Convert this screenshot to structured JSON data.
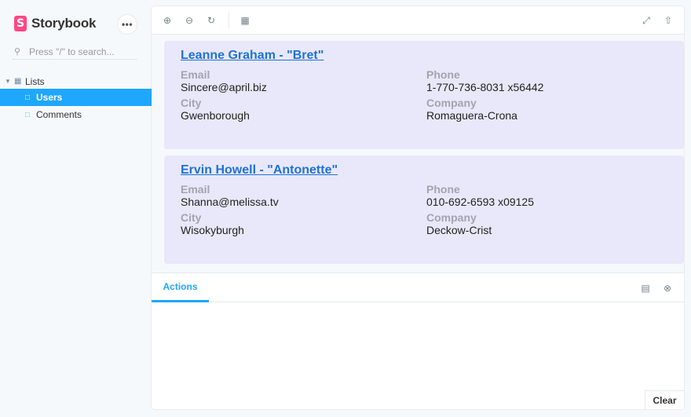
{
  "app": {
    "name": "Storybook",
    "logo_letter": "S",
    "menu_glyph": "•••"
  },
  "search": {
    "placeholder": "Press \"/\" to search..."
  },
  "sidebar": {
    "group": {
      "label": "Lists"
    },
    "items": [
      {
        "label": "Users",
        "active": true
      },
      {
        "label": "Comments",
        "active": false
      }
    ]
  },
  "toolbar": {
    "icons": [
      "zoom-in-icon",
      "zoom-out-icon",
      "zoom-reset-icon",
      "grid-icon",
      "fullscreen-icon",
      "share-icon"
    ]
  },
  "users": [
    {
      "title": "Leanne Graham - \"Bret\"",
      "email_label": "Email",
      "email": "Sincere@april.biz",
      "phone_label": "Phone",
      "phone": "1-770-736-8031 x56442",
      "city_label": "City",
      "city": "Gwenborough",
      "company_label": "Company",
      "company": "Romaguera-Crona"
    },
    {
      "title": "Ervin Howell - \"Antonette\"",
      "email_label": "Email",
      "email": "Shanna@melissa.tv",
      "phone_label": "Phone",
      "phone": "010-692-6593 x09125",
      "city_label": "City",
      "city": "Wisokyburgh",
      "company_label": "Company",
      "company": "Deckow-Crist"
    }
  ],
  "addons": {
    "active_tab": "Actions",
    "clear_label": "Clear"
  },
  "colors": {
    "accent": "#1ea7fd",
    "brand": "#ff4785",
    "link": "#1f73d2",
    "card_bg": "#e8e8fa"
  }
}
